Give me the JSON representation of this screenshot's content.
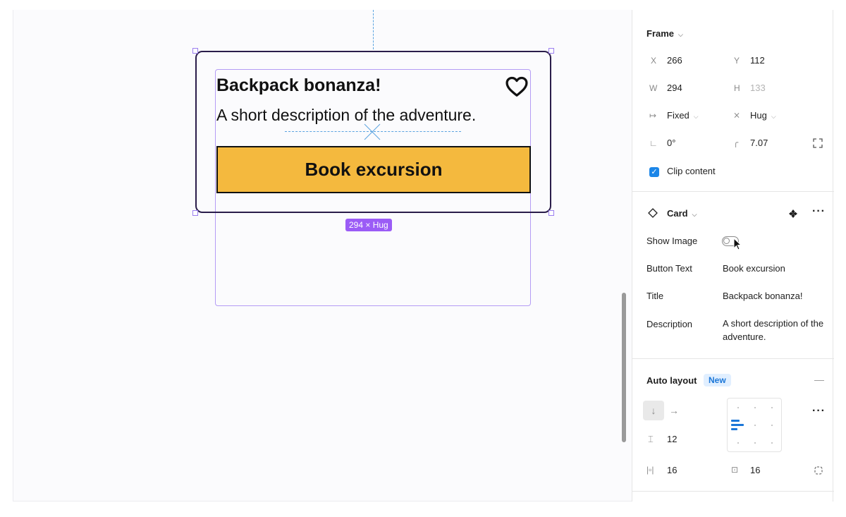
{
  "canvas": {
    "card": {
      "title": "Backpack bonanza!",
      "description": "A short description of the adventure.",
      "button_label": "Book excursion"
    },
    "size_tag": "294 × Hug"
  },
  "panel": {
    "frame": {
      "title": "Frame",
      "x_label": "X",
      "x_value": "266",
      "y_label": "Y",
      "y_value": "112",
      "w_label": "W",
      "w_value": "294",
      "h_label": "H",
      "h_value": "133",
      "width_mode": "Fixed",
      "height_mode": "Hug",
      "rotation": "0°",
      "radius": "7.07",
      "clip_content": "Clip content"
    },
    "component": {
      "title": "Card",
      "props": {
        "show_image_label": "Show Image",
        "show_image_on": false,
        "button_text_label": "Button Text",
        "button_text_value": "Book excursion",
        "title_label": "Title",
        "title_value": "Backpack bonanza!",
        "description_label": "Description",
        "description_value": "A short description of the adventure."
      }
    },
    "auto_layout": {
      "title": "Auto layout",
      "badge": "New",
      "gap": "12",
      "padding_horizontal": "16",
      "padding_vertical": "16"
    }
  },
  "colors": {
    "button_fill": "#f4b93e",
    "selection": "#9b5cf6",
    "guide": "#5aa3e0",
    "accent_blue": "#1c86e8"
  }
}
